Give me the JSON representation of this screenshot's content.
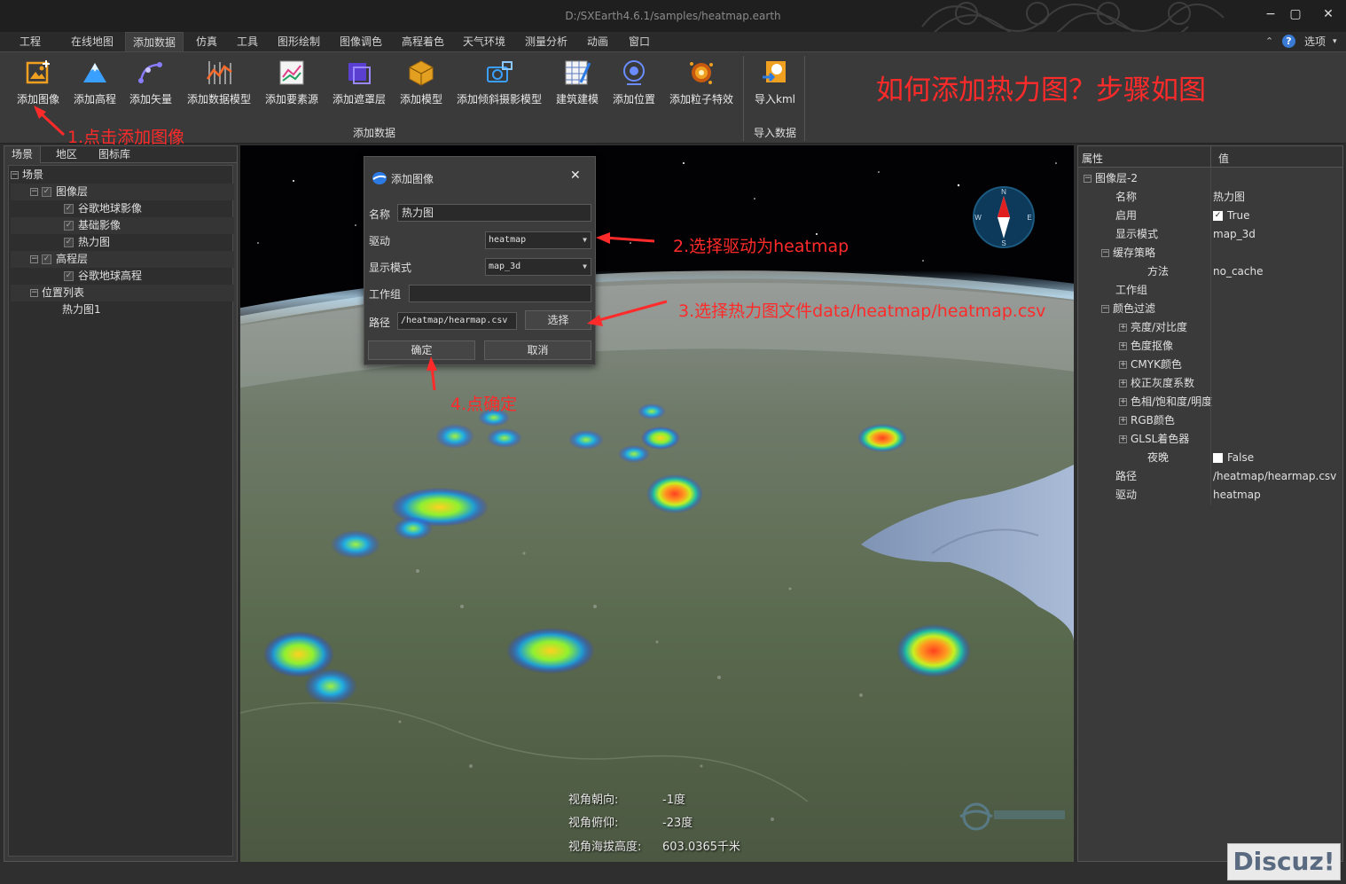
{
  "window": {
    "title": "D:/SXEarth4.6.1/samples/heatmap.earth",
    "buttons": {
      "minimize": "−",
      "restore": "▢",
      "close": "✕"
    }
  },
  "menu": {
    "items": [
      "工程",
      "在线地图",
      "添加数据",
      "仿真",
      "工具",
      "图形绘制",
      "图像调色",
      "高程着色",
      "天气环境",
      "测量分析",
      "动画",
      "窗口"
    ],
    "active": "添加数据",
    "right": {
      "options_label": "选项",
      "help_icon": "?",
      "up_icon": "⌃",
      "dropdown_icon": "▾"
    }
  },
  "ribbon": {
    "buttons": [
      {
        "label": "添加图像",
        "icon": "add-image-icon"
      },
      {
        "label": "添加高程",
        "icon": "add-elevation-icon"
      },
      {
        "label": "添加矢量",
        "icon": "add-vector-icon"
      },
      {
        "label": "添加数据模型",
        "icon": "add-data-model-icon"
      },
      {
        "label": "添加要素源",
        "icon": "add-feature-source-icon"
      },
      {
        "label": "添加遮罩层",
        "icon": "add-mask-layer-icon"
      },
      {
        "label": "添加模型",
        "icon": "add-model-icon"
      },
      {
        "label": "添加倾斜摄影模型",
        "icon": "add-oblique-photo-model-icon"
      },
      {
        "label": "建筑建模",
        "icon": "building-modeling-icon"
      },
      {
        "label": "添加位置",
        "icon": "add-location-icon"
      },
      {
        "label": "添加粒子特效",
        "icon": "add-particle-effect-icon"
      },
      {
        "label": "导入kml",
        "icon": "import-kml-icon"
      }
    ],
    "group_add": "添加数据",
    "group_import": "导入数据"
  },
  "left_panel": {
    "tabs": [
      "场景",
      "地区",
      "图标库"
    ],
    "tree": {
      "root": "场景",
      "image_layer": "图像层",
      "image_items": [
        "谷歌地球影像",
        "基础影像",
        "热力图"
      ],
      "elevation_layer": "高程层",
      "elevation_items": [
        "谷歌地球高程"
      ],
      "position_list": "位置列表",
      "position_items": [
        "热力图1"
      ]
    }
  },
  "viewport": {
    "hud": {
      "heading_label": "视角朝向:",
      "heading_value": "-1度",
      "pitch_label": "视角俯仰:",
      "pitch_value": "-23度",
      "altitude_label": "视角海拔高度:",
      "altitude_value": "603.0365千米"
    },
    "compass": {
      "n": "N",
      "s": "S",
      "e": "E",
      "w": "W"
    }
  },
  "dialog": {
    "title": "添加图像",
    "close": "✕",
    "fields": {
      "name_label": "名称",
      "name_value": "热力图",
      "driver_label": "驱动",
      "driver_value": "heatmap",
      "mode_label": "显示模式",
      "mode_value": "map_3d",
      "workgroup_label": "工作组",
      "workgroup_value": "",
      "path_label": "路径",
      "path_value": "/heatmap/hearmap.csv"
    },
    "choose_button": "选择",
    "ok_button": "确定",
    "cancel_button": "取消"
  },
  "annotations": {
    "headline": "如何添加热力图？步骤如图",
    "step1": "1.点击添加图像",
    "step2": "2.选择驱动为heatmap",
    "step3": "3.选择热力图文件data/heatmap/heatmap.csv",
    "step4": "4.点确定",
    "color": "#ff2a2a"
  },
  "properties": {
    "header_key": "属性",
    "header_value": "值",
    "layer": "图像层-2",
    "rows": [
      {
        "key": "名称",
        "value": "热力图"
      },
      {
        "key": "启用",
        "value": "True",
        "checkbox": true
      },
      {
        "key": "显示模式",
        "value": "map_3d"
      },
      {
        "key": "缓存策略",
        "value": ""
      },
      {
        "key": "方法",
        "value": "no_cache"
      },
      {
        "key": "工作组",
        "value": ""
      },
      {
        "key": "颜色过滤",
        "value": ""
      },
      {
        "key": "亮度/对比度",
        "value": ""
      },
      {
        "key": "色度抠像",
        "value": ""
      },
      {
        "key": "CMYK颜色",
        "value": ""
      },
      {
        "key": "校正灰度系数",
        "value": ""
      },
      {
        "key": "色相/饱和度/明度",
        "value": ""
      },
      {
        "key": "RGB颜色",
        "value": ""
      },
      {
        "key": "GLSL着色器",
        "value": ""
      },
      {
        "key": "夜晚",
        "value": "False",
        "checkbox": false
      },
      {
        "key": "路径",
        "value": "/heatmap/hearmap.csv"
      },
      {
        "key": "驱动",
        "value": "heatmap"
      }
    ]
  },
  "watermark": "Discuz!"
}
